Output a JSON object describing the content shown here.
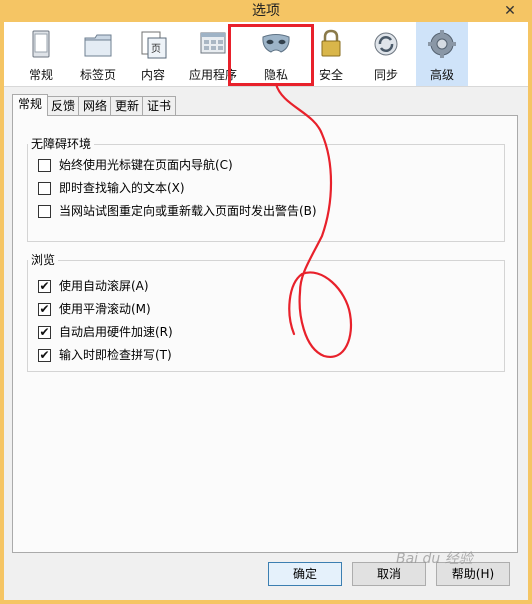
{
  "window": {
    "title": "选项",
    "close_glyph": "✕"
  },
  "toolbar": {
    "panes": [
      {
        "id": "general",
        "label": "常规",
        "icon": "general-window-icon"
      },
      {
        "id": "tabs",
        "label": "标签页",
        "icon": "tabs-folder-icon"
      },
      {
        "id": "content",
        "label": "内容",
        "icon": "content-page-icon",
        "icon_text": "页"
      },
      {
        "id": "applications",
        "label": "应用程序",
        "icon": "applications-icon"
      },
      {
        "id": "privacy",
        "label": "隐私",
        "icon": "privacy-mask-icon"
      },
      {
        "id": "security",
        "label": "安全",
        "icon": "security-lock-icon"
      },
      {
        "id": "sync",
        "label": "同步",
        "icon": "sync-icon"
      },
      {
        "id": "advanced",
        "label": "高级",
        "icon": "advanced-gear-icon"
      }
    ],
    "selected": "advanced",
    "highlighted": "privacy"
  },
  "subtabs": [
    "常规",
    "反馈",
    "网络",
    "更新",
    "证书"
  ],
  "active_subtab": "常规",
  "groups": {
    "accessibility": {
      "title": "无障碍环境",
      "items": [
        {
          "label": "始终使用光标键在页面内导航(C)",
          "checked": false
        },
        {
          "label": "即时查找输入的文本(X)",
          "checked": false
        },
        {
          "label": "当网站试图重定向或重新载入页面时发出警告(B)",
          "checked": false
        }
      ]
    },
    "browsing": {
      "title": "浏览",
      "items": [
        {
          "label": "使用自动滚屏(A)",
          "checked": true
        },
        {
          "label": "使用平滑滚动(M)",
          "checked": true
        },
        {
          "label": "自动启用硬件加速(R)",
          "checked": true
        },
        {
          "label": "输入时即检查拼写(T)",
          "checked": true
        }
      ]
    }
  },
  "buttons": {
    "ok": "确定",
    "cancel": "取消",
    "help": "帮助(H)"
  },
  "watermark": "Bai du 经验",
  "colors": {
    "titlebar": "#f5c564",
    "highlight": "#e8212b",
    "selected_pane": "#cfe3f9"
  },
  "check_glyph": "✔"
}
